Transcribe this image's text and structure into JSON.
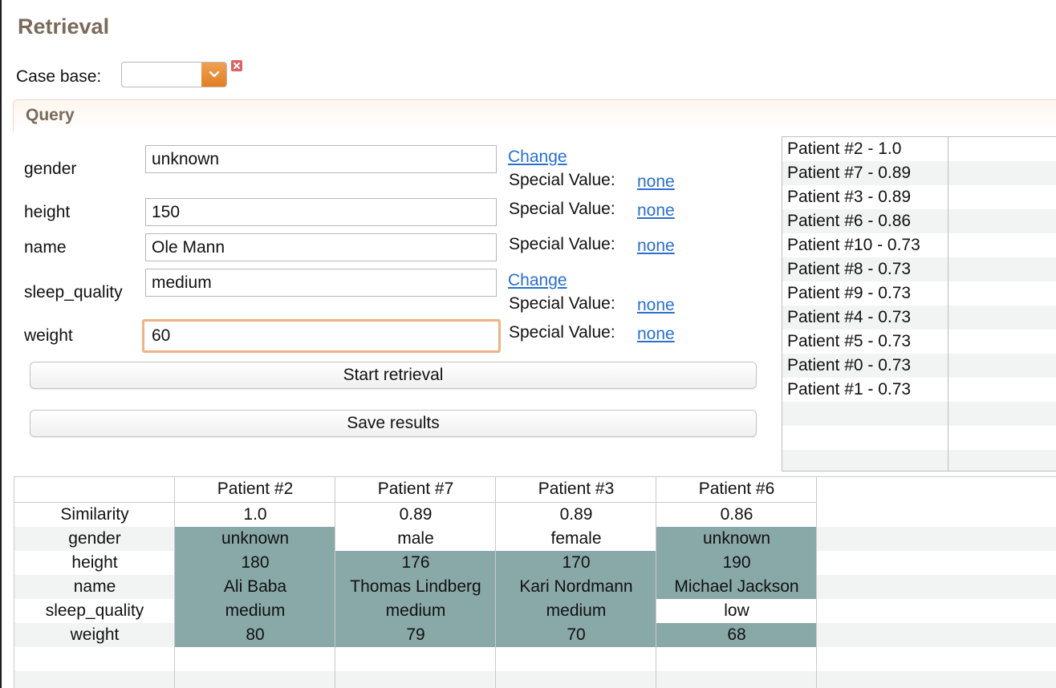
{
  "panel": {
    "title": "Retrieval"
  },
  "case_base": {
    "label": "Case base:",
    "selected": ""
  },
  "query": {
    "title": "Query",
    "fields": [
      {
        "label": "gender",
        "value": "unknown",
        "change_link": "Change",
        "special_label": "Special Value:",
        "special_value": "none"
      },
      {
        "label": "height",
        "value": "150",
        "special_label": "Special Value:",
        "special_value": "none"
      },
      {
        "label": "name",
        "value": "Ole Mann",
        "special_label": "Special Value:",
        "special_value": "none"
      },
      {
        "label": "sleep_quality",
        "value": "medium",
        "change_link": "Change",
        "special_label": "Special Value:",
        "special_value": "none"
      },
      {
        "label": "weight",
        "value": "60",
        "special_label": "Special Value:",
        "special_value": "none"
      }
    ],
    "start_button": "Start retrieval",
    "save_button": "Save results"
  },
  "results_list": [
    "Patient #2 - 1.0",
    "Patient #7 - 0.89",
    "Patient #3 - 0.89",
    "Patient #6 - 0.86",
    "Patient #10 - 0.73",
    "Patient #8 - 0.73",
    "Patient #9 - 0.73",
    "Patient #4 - 0.73",
    "Patient #5 - 0.73",
    "Patient #0 - 0.73",
    "Patient #1 - 0.73"
  ],
  "comparison": {
    "columns": [
      "Patient #2",
      "Patient #7",
      "Patient #3",
      "Patient #6"
    ],
    "rows": [
      {
        "label": "Similarity",
        "cells": [
          "1.0",
          "0.89",
          "0.89",
          "0.86"
        ]
      },
      {
        "label": "gender",
        "cells": [
          "unknown",
          "male",
          "female",
          "unknown"
        ]
      },
      {
        "label": "height",
        "cells": [
          "180",
          "176",
          "170",
          "190"
        ]
      },
      {
        "label": "name",
        "cells": [
          "Ali Baba",
          "Thomas Lindberg",
          "Kari Nordmann",
          "Michael Jackson"
        ]
      },
      {
        "label": "sleep_quality",
        "cells": [
          "medium",
          "medium",
          "medium",
          "low"
        ]
      },
      {
        "label": "weight",
        "cells": [
          "80",
          "79",
          "70",
          "68"
        ]
      }
    ],
    "match_highlight_color": "#89a8a8"
  },
  "colors": {
    "panel_title": "#7a6a5a",
    "link": "#2a6fcf",
    "dropdown_accent": "#e88f35",
    "focus_border": "#edb286",
    "clear_icon": "#d96262"
  }
}
